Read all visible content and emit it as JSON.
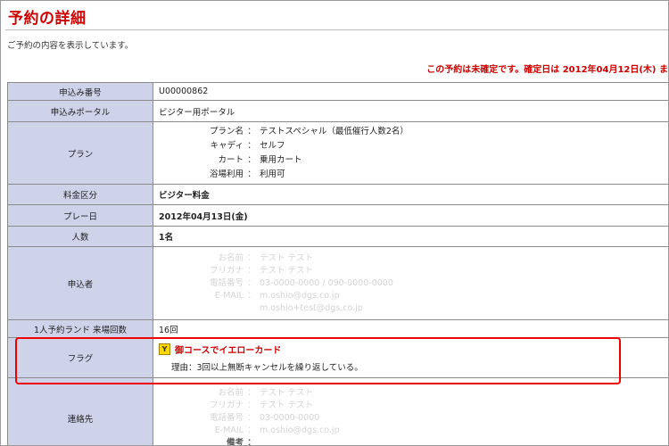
{
  "page": {
    "title": "予約の詳細",
    "subtitle": "ご予約の内容を表示しています。",
    "notice": "この予約は未確定です。確定日は 2012年04月12日(木) ま"
  },
  "rows": {
    "app_no": {
      "label": "申込み番号",
      "value": "U00000862"
    },
    "portal": {
      "label": "申込みポータル",
      "value": "ビジター用ポータル"
    },
    "plan": {
      "label": "プラン",
      "items": [
        {
          "key": "プラン名",
          "sep": "：",
          "value": "テストスペシャル（最低催行人数2名）"
        },
        {
          "key": "キャディ",
          "sep": "：",
          "value": "セルフ"
        },
        {
          "key": "カート",
          "sep": "：",
          "value": "乗用カート"
        },
        {
          "key": "浴場利用",
          "sep": "：",
          "value": "利用可"
        }
      ]
    },
    "fee": {
      "label": "料金区分",
      "value": "ビジター料金"
    },
    "play_date": {
      "label": "プレー日",
      "value": "2012年04月13日(金)"
    },
    "people": {
      "label": "人数",
      "value": "1名"
    },
    "applicant": {
      "label": "申込者",
      "items": [
        {
          "key": "お名前",
          "sep": "：",
          "value": "テスト テスト"
        },
        {
          "key": "フリガナ",
          "sep": "：",
          "value": "テスト テスト"
        },
        {
          "key": "電話番号",
          "sep": "：",
          "value": "03-0000-0000 / 090-0000-0000"
        },
        {
          "key": "E-MAIL",
          "sep": "：",
          "value": "m.oshio@dgs.co.jp"
        }
      ],
      "extra": "m.oshio+test@dgs.co.jp"
    },
    "visits": {
      "label": "1人予約ランド 来場回数",
      "value": "16回"
    },
    "flag": {
      "label": "フラグ",
      "icon": "Y",
      "title": "御コースでイエローカード",
      "reason": "理由：3回以上無断キャンセルを繰り返している。"
    },
    "contact": {
      "label": "連絡先",
      "items": [
        {
          "key": "お名前",
          "sep": "：",
          "value": "テスト テスト"
        },
        {
          "key": "フリガナ",
          "sep": "：",
          "value": "テスト テスト"
        },
        {
          "key": "電話番号",
          "sep": "：",
          "value": "03-0000-0000"
        },
        {
          "key": "E-MAIL",
          "sep": "：",
          "value": "m.oshio@dgs.co.jp"
        }
      ],
      "extra_key": "備考",
      "extra_sep": "："
    }
  },
  "colors": {
    "accent": "#cc0000",
    "label_bg": "#cfd3ea",
    "highlight": "#ee0000",
    "flag_icon": "#ffd800"
  }
}
